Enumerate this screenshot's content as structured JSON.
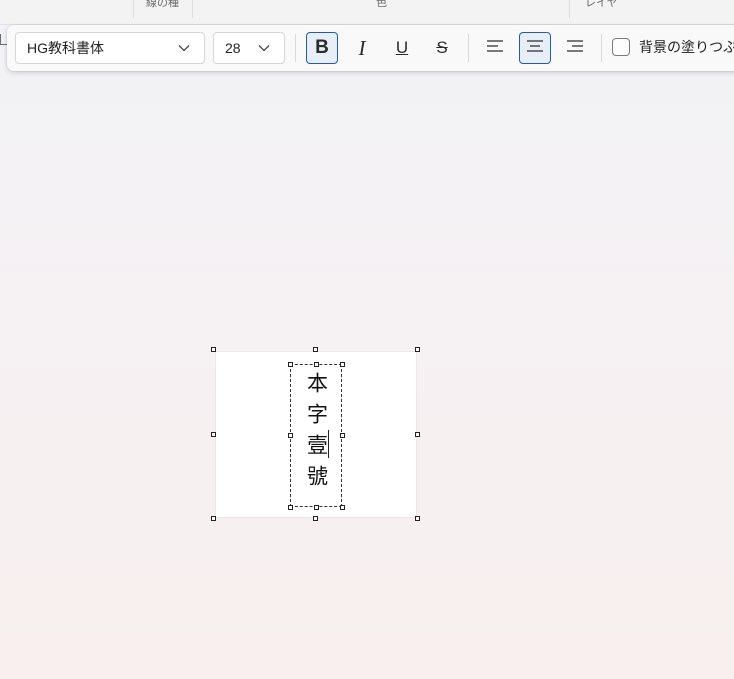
{
  "ribbon": {
    "group_labels": [
      "線の種",
      "色",
      "レイヤ"
    ]
  },
  "toolbar": {
    "font_family": "HG教科書体",
    "font_size": "28",
    "bold_label": "B",
    "italic_label": "I",
    "underline_label": "U",
    "strike_label": "S",
    "fill_checkbox_label": "背景の塗りつぶし",
    "fill_checked": false,
    "bold_active": true,
    "align_active": "center"
  },
  "canvas": {
    "text": "本字壹號"
  },
  "icons": {
    "chevron": "chevron-down-icon",
    "align_left": "align-left-icon",
    "align_center": "align-center-icon",
    "align_right": "align-right-icon"
  },
  "colors": {
    "accent": "#1e5fa8",
    "canvas_bg": "#f6f1f3",
    "toolbar_bg": "#f9f9f9"
  }
}
